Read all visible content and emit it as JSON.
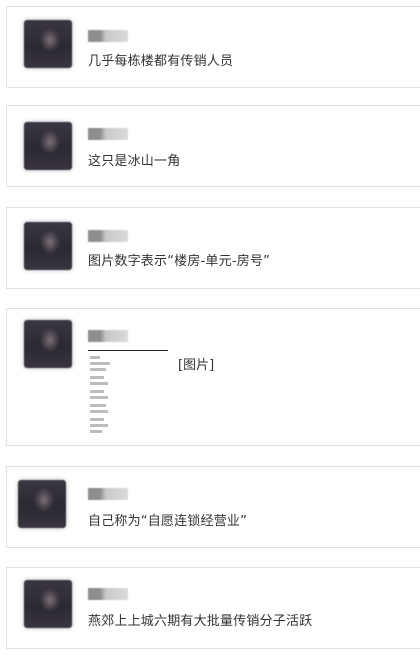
{
  "messages": [
    {
      "text": "几乎每栋楼都有传销人员"
    },
    {
      "text": "这只是冰山一角"
    },
    {
      "text": "图片数字表示“楼房-单元-房号”"
    },
    {
      "text": "[图片]"
    },
    {
      "text": "自己称为“自愿连锁经营业”"
    },
    {
      "text": "燕郊上上城六期有大批量传销分子活跃"
    }
  ]
}
